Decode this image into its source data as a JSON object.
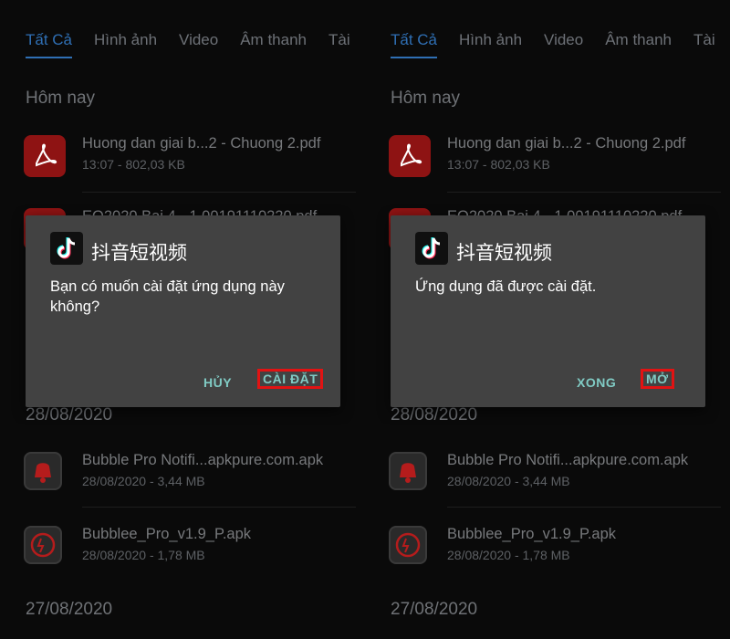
{
  "screens": [
    {
      "tabs": [
        "Tất Cả",
        "Hình ảnh",
        "Video",
        "Âm thanh",
        "Tài"
      ],
      "sections": {
        "today": "Hôm nay",
        "date1": "28/08/2020",
        "date2": "27/08/2020"
      },
      "files": [
        {
          "name": "Huong dan giai b...2 - Chuong 2.pdf",
          "meta": "13:07 - 802,03 KB",
          "icon": "pdf-icon"
        },
        {
          "name": "EO2020 Bai 4 - 1 00191110220.pdf",
          "meta": "",
          "icon": "pdf-icon"
        },
        {
          "name": "Bubble Pro Notifi...apkpure.com.apk",
          "meta": "28/08/2020 - 3,44 MB",
          "icon": "bell-icon"
        },
        {
          "name": "Bubblee_Pro_v1.9_P.apk",
          "meta": "28/08/2020 - 1,78 MB",
          "icon": "bubble-icon"
        }
      ],
      "dialog": {
        "app_name": "抖音短视频",
        "message": "Bạn có muốn cài đặt ứng dụng này không?",
        "secondary_button": "HỦY",
        "primary_button": "CÀI ĐẶT"
      }
    },
    {
      "tabs": [
        "Tất Cả",
        "Hình ảnh",
        "Video",
        "Âm thanh",
        "Tài"
      ],
      "sections": {
        "today": "Hôm nay",
        "date1": "28/08/2020",
        "date2": "27/08/2020"
      },
      "files": [
        {
          "name": "Huong dan giai b...2 - Chuong 2.pdf",
          "meta": "13:07 - 802,03 KB",
          "icon": "pdf-icon"
        },
        {
          "name": "EO2020 Bai 4 - 1 00191110220.pdf",
          "meta": "",
          "icon": "pdf-icon"
        },
        {
          "name": "Bubble Pro Notifi...apkpure.com.apk",
          "meta": "28/08/2020 - 3,44 MB",
          "icon": "bell-icon"
        },
        {
          "name": "Bubblee_Pro_v1.9_P.apk",
          "meta": "28/08/2020 - 1,78 MB",
          "icon": "bubble-icon"
        }
      ],
      "dialog": {
        "app_name": "抖音短视频",
        "message": "Ứng dụng đã được cài đặt.",
        "secondary_button": "XONG",
        "primary_button": "MỞ"
      }
    }
  ],
  "colors": {
    "tab_active": "#2f6fb4",
    "dialog_bg": "#424242",
    "button_text": "#80cbc4",
    "highlight_box": "#e11313",
    "pdf_icon": "#8e1313"
  }
}
